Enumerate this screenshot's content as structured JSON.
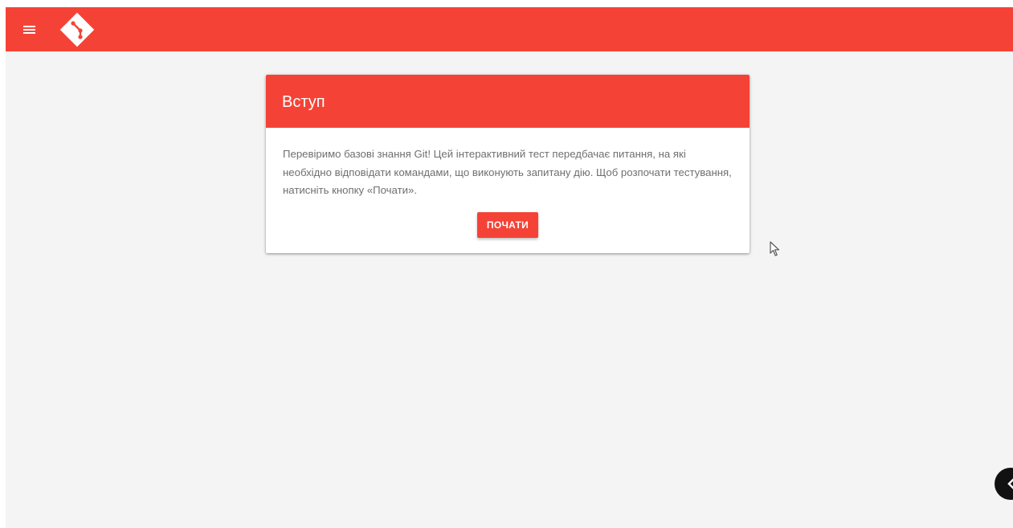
{
  "header": {
    "menu_icon": "hamburger-menu-icon",
    "logo_icon": "git-logo-icon"
  },
  "card": {
    "title": "Вступ",
    "text": "Перевіримо базові знання Git! Цей інтерактивний тест передбачає питання, на які необхідно відповідати командами, що виконують запитану дію. Щоб розпочати тестування, натисніть кнопку «Почати».",
    "start_label": "ПОЧАТИ"
  },
  "floating_button": {
    "icon": "chevron-left-icon"
  },
  "colors": {
    "accent": "#f44336",
    "background": "#f4f4f4",
    "card": "#ffffff",
    "text": "#6f6f6f"
  }
}
